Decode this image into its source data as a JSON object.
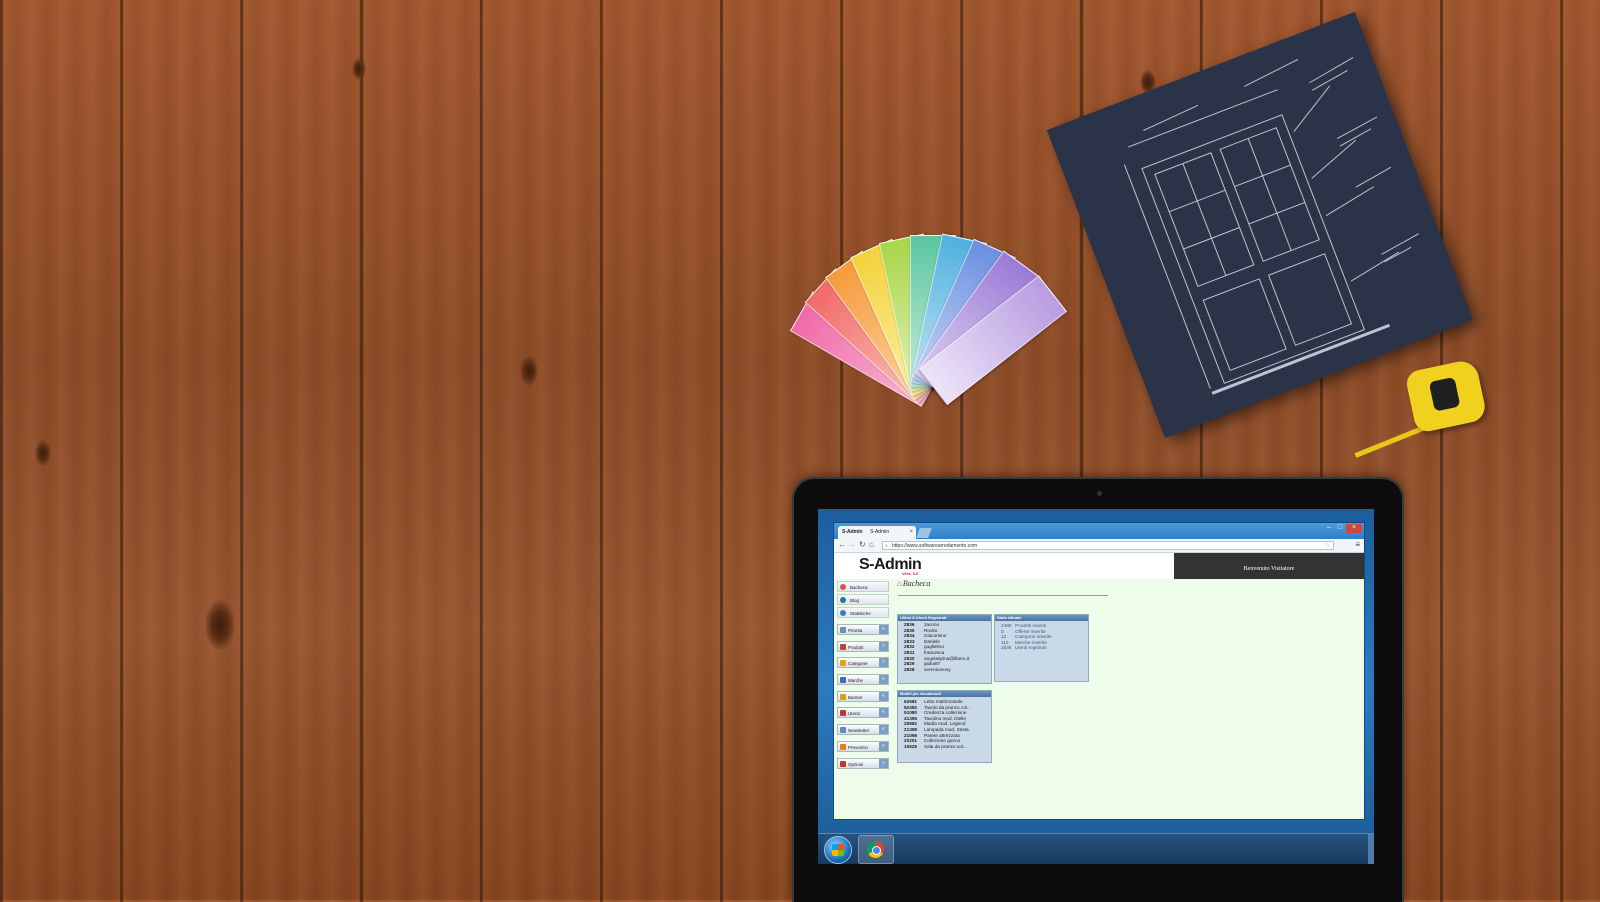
{
  "browser": {
    "tab_title": "S-Admin",
    "tab_title_extra": "S-Admin",
    "tab_close": "×",
    "url": "https://www.softwarearredamento.com",
    "menu_icon": "≡"
  },
  "app": {
    "logo": "S-Admin",
    "version": "Vers. 3.0",
    "welcome": "Benvenuto Visitatore",
    "page_title": "Bacheca"
  },
  "sidebar": {
    "links": [
      {
        "label": "Bacheca",
        "color": "#d9534f"
      },
      {
        "label": "Blog",
        "color": "#21759b"
      },
      {
        "label": "Statistiche",
        "color": "#3b7bbf"
      }
    ],
    "buttons": [
      {
        "label": "Priorita",
        "color": "#6a8fb3"
      },
      {
        "label": "Prodotti",
        "color": "#b5473a"
      },
      {
        "label": "Categorie",
        "color": "#e3a21a"
      },
      {
        "label": "Marche",
        "color": "#3b6fb5"
      },
      {
        "label": "Banner",
        "color": "#d4a017"
      },
      {
        "label": "Utenti",
        "color": "#c0392b"
      },
      {
        "label": "Newsletter",
        "color": "#5b8ec2"
      },
      {
        "label": "Preventivi",
        "color": "#e67e22"
      },
      {
        "label": "Opzioni",
        "color": "#c0392b"
      }
    ],
    "arrow": "«"
  },
  "panels": {
    "users": {
      "title": "Ultimi 8 Utenti Registrati",
      "rows": [
        {
          "id": "2836",
          "name": "Jacono"
        },
        {
          "id": "2835",
          "name": "Rovito"
        },
        {
          "id": "2834",
          "name": "Giacomino"
        },
        {
          "id": "2833",
          "name": "Daniele"
        },
        {
          "id": "2832",
          "name": "guglielmo"
        },
        {
          "id": "2831",
          "name": "francesca"
        },
        {
          "id": "2830",
          "name": "angelaspina@libero.it"
        },
        {
          "id": "2829",
          "name": "giulia87"
        },
        {
          "id": "2828",
          "name": "serenicarosy"
        }
      ]
    },
    "status": {
      "title": "Stato Attuale",
      "rows": [
        {
          "count": "2488",
          "label": "Prodotti inseriti"
        },
        {
          "count": "0",
          "label": "Offerte inserite"
        },
        {
          "count": "12",
          "label": "Categorie inserite"
        },
        {
          "count": "110",
          "label": "Marche inserite"
        },
        {
          "count": "2836",
          "label": "Utenti registrati"
        }
      ]
    },
    "viewed": {
      "title": "Mobili più visualizzati",
      "rows": [
        {
          "views": "62581",
          "name": "Letto matrimoniale"
        },
        {
          "views": "52392",
          "name": "Tavolo da pranzo col..."
        },
        {
          "views": "51080",
          "name": "Credenza collezione"
        },
        {
          "views": "41355",
          "name": "Tavolino mod. Dielle"
        },
        {
          "views": "25882",
          "name": "Madia mod. Legend"
        },
        {
          "views": "21398",
          "name": "Lampada mod. Sesta"
        },
        {
          "views": "21098",
          "name": "Parete attrezzata"
        },
        {
          "views": "20201",
          "name": "Collezione giorno"
        },
        {
          "views": "15529",
          "name": "Sala da pranzo col..."
        }
      ]
    }
  }
}
